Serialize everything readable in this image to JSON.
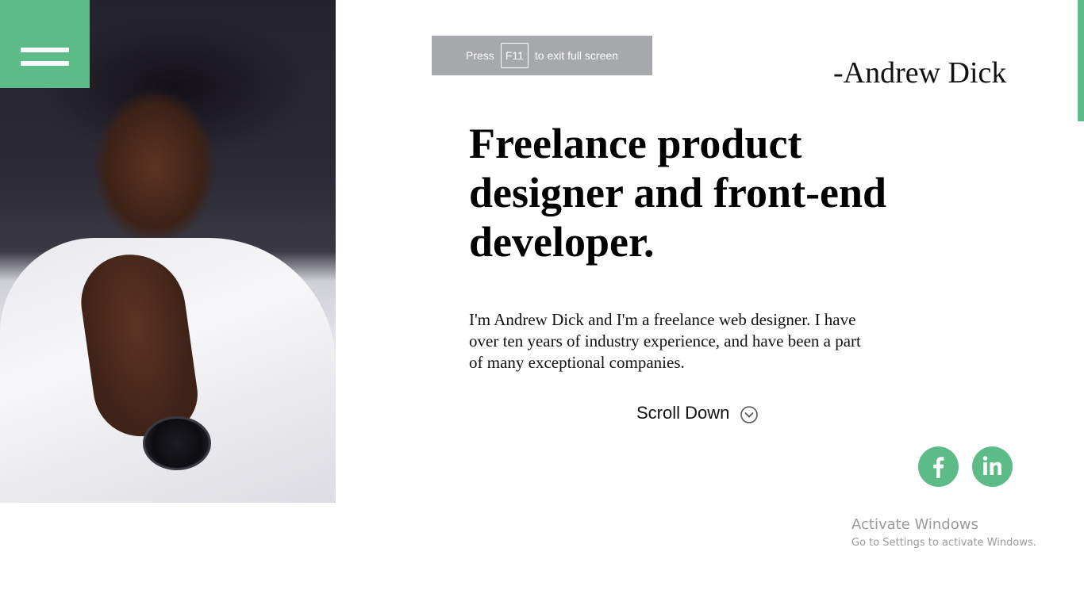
{
  "hero": {
    "photo_alt": "Portrait of Andrew Dick",
    "signature": "-Andrew Dick",
    "headline": "Freelance product designer and front-end developer.",
    "intro": "I'm Andrew Dick and I'm a freelance web designer. I have over ten years of industry experience, and have been a part of many exceptional companies.",
    "scroll_label": "Scroll Down"
  },
  "fullscreen_notice": {
    "before": "Press",
    "key": "F11",
    "after": "to exit full screen"
  },
  "social": {
    "facebook_icon": "facebook-icon",
    "linkedin_icon": "linkedin-icon"
  },
  "watermark": {
    "title": "Activate Windows",
    "subtitle": "Go to Settings to activate Windows."
  },
  "colors": {
    "accent": "#5dbb88",
    "notice_bg": "#a7a8ab",
    "text": "#000000"
  }
}
